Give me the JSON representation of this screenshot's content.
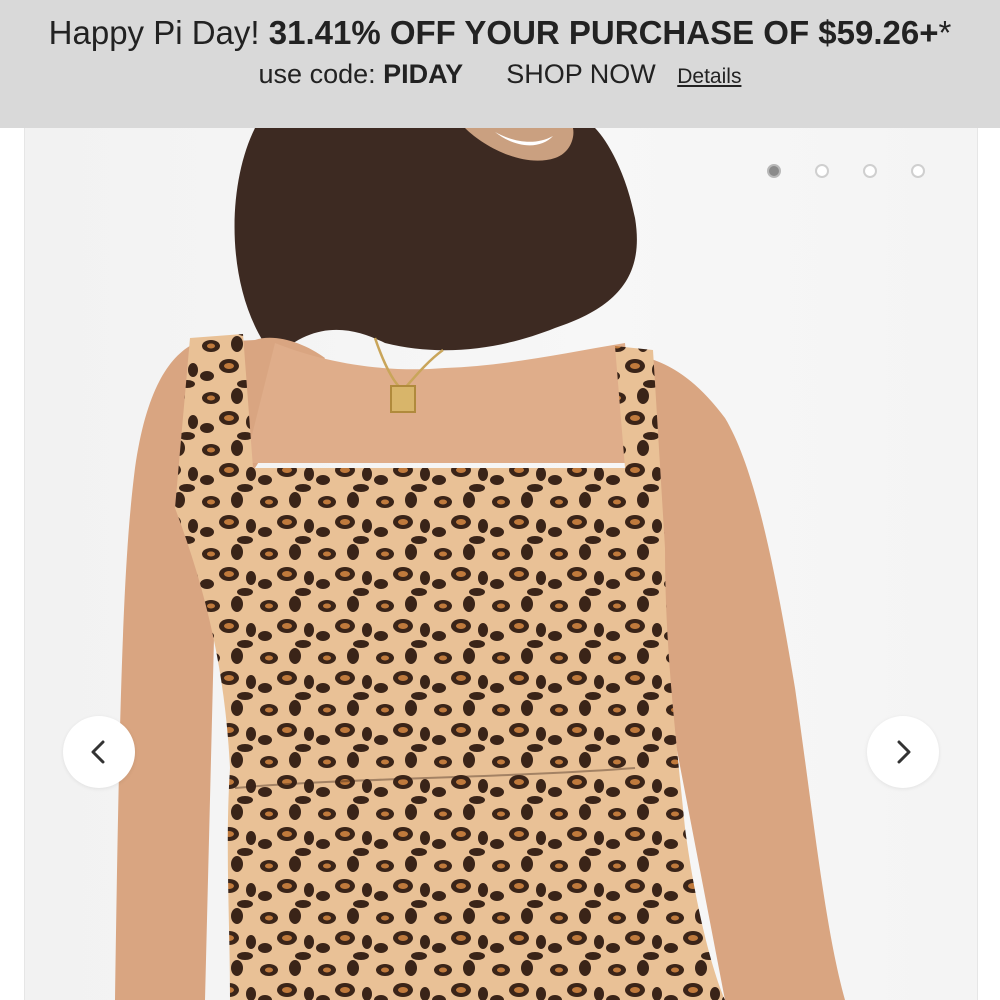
{
  "promo": {
    "intro": "Happy Pi Day!",
    "offer": "31.41% OFF YOUR PURCHASE OF $59.26+",
    "asterisk": "*",
    "code_label": "use code:",
    "code": "PIDAY",
    "shop_now": "SHOP NOW",
    "details": "Details",
    "background": "#d9d9d9"
  },
  "gallery": {
    "image_count": 4,
    "active_index": 0,
    "prev_icon": "chevron-left-icon",
    "next_icon": "chevron-right-icon",
    "print_colors": [
      "#e8b98a",
      "#3a2418",
      "#c07a3c"
    ]
  }
}
